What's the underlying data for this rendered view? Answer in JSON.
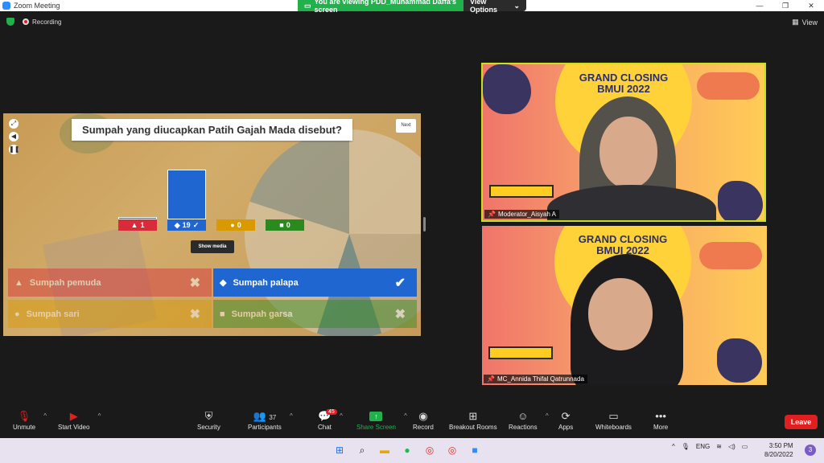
{
  "window": {
    "title": "Zoom Meeting"
  },
  "share_banner": {
    "text": "You are viewing PDD_Muhammad Daffa's screen",
    "view_options": "View Options"
  },
  "recording": {
    "label": "Recording"
  },
  "view": {
    "label": "View"
  },
  "quiz": {
    "question": "Sumpah yang diucapkan Patih Gajah Mada disebut?",
    "next_label": "Next",
    "show_media_label": "Show media",
    "results": [
      {
        "symbol": "▲",
        "count": "1",
        "value": 1,
        "color": "#d92c3a"
      },
      {
        "symbol": "◆",
        "count": "19",
        "check": "✓",
        "value": 19,
        "color": "#1f66d1"
      },
      {
        "symbol": "●",
        "count": "0",
        "value": 0,
        "color": "#d89a00"
      },
      {
        "symbol": "■",
        "count": "0",
        "value": 0,
        "color": "#2a8a1e"
      }
    ],
    "answers": [
      {
        "symbol": "▲",
        "label": "Sumpah pemuda",
        "mark": "✖",
        "color": "#d92c3a"
      },
      {
        "symbol": "◆",
        "label": "Sumpah palapa",
        "mark": "✔",
        "color": "#1f66d1"
      },
      {
        "symbol": "●",
        "label": "Sumpah sari",
        "mark": "✖",
        "color": "#d89a00"
      },
      {
        "symbol": "■",
        "label": "Sumpah garsa",
        "mark": "✖",
        "color": "#2a8a1e"
      }
    ]
  },
  "tiles": [
    {
      "banner_line1": "GRAND CLOSING",
      "banner_line2": "BMUI 2022",
      "name": "Moderator_Aisyah A"
    },
    {
      "banner_line1": "GRAND CLOSING",
      "banner_line2": "BMUI 2022",
      "name": "MC_Annida Thifal Qatrunnada"
    }
  ],
  "toolbar": {
    "unmute": "Unmute",
    "start_video": "Start Video",
    "security": "Security",
    "participants": "Participants",
    "participants_count": "37",
    "chat": "Chat",
    "chat_badge": "45",
    "share_screen": "Share Screen",
    "record": "Record",
    "breakout_rooms": "Breakout Rooms",
    "reactions": "Reactions",
    "apps": "Apps",
    "whiteboards": "Whiteboards",
    "more": "More",
    "leave": "Leave"
  },
  "taskbar": {
    "lang": "ENG",
    "time": "3:50 PM",
    "date": "8/20/2022",
    "notifications": "3"
  }
}
